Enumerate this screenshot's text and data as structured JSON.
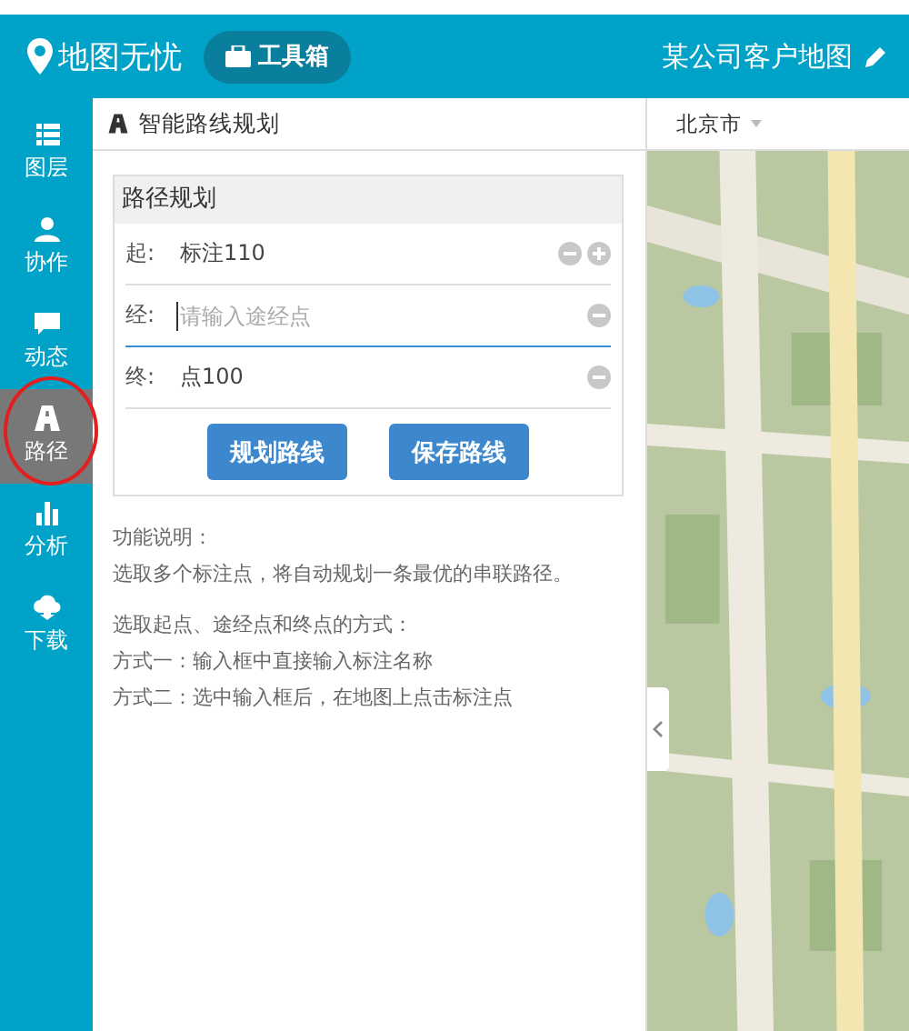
{
  "header": {
    "logo": "地图无忧",
    "toolbox_button": "工具箱",
    "map_title": "某公司客户地图"
  },
  "sidebar": {
    "items": [
      {
        "label": "图层",
        "kind": "layers",
        "selected": false
      },
      {
        "label": "协作",
        "kind": "people",
        "selected": false
      },
      {
        "label": "动态",
        "kind": "chat",
        "selected": false
      },
      {
        "label": "路径",
        "kind": "road",
        "selected": true
      },
      {
        "label": "分析",
        "kind": "chart",
        "selected": false
      },
      {
        "label": "下载",
        "kind": "cloud",
        "selected": false
      }
    ]
  },
  "panel": {
    "title": "智能路线规划",
    "card_title": "路径规划",
    "stops": [
      {
        "label": "起:",
        "value": "标注110",
        "focused": false,
        "can_add": true
      },
      {
        "label": "经:",
        "placeholder": "请输入途经点",
        "focused": true,
        "can_add": false
      },
      {
        "label": "终:",
        "value": "点100",
        "focused": false,
        "can_add": false
      }
    ],
    "buttons": [
      "规划路线",
      "保存路线"
    ],
    "help_title": "功能说明：",
    "help_lines": [
      "选取多个标注点，将自动规划一条最优的串联路径。"
    ],
    "method_lines": [
      "选取起点、途经点和终点的方式：",
      "方式一：输入框中直接输入标注名称",
      "方式二：选中输入框后，在地图上点击标注点"
    ]
  },
  "map": {
    "city": "北京市",
    "kind": "picture"
  }
}
